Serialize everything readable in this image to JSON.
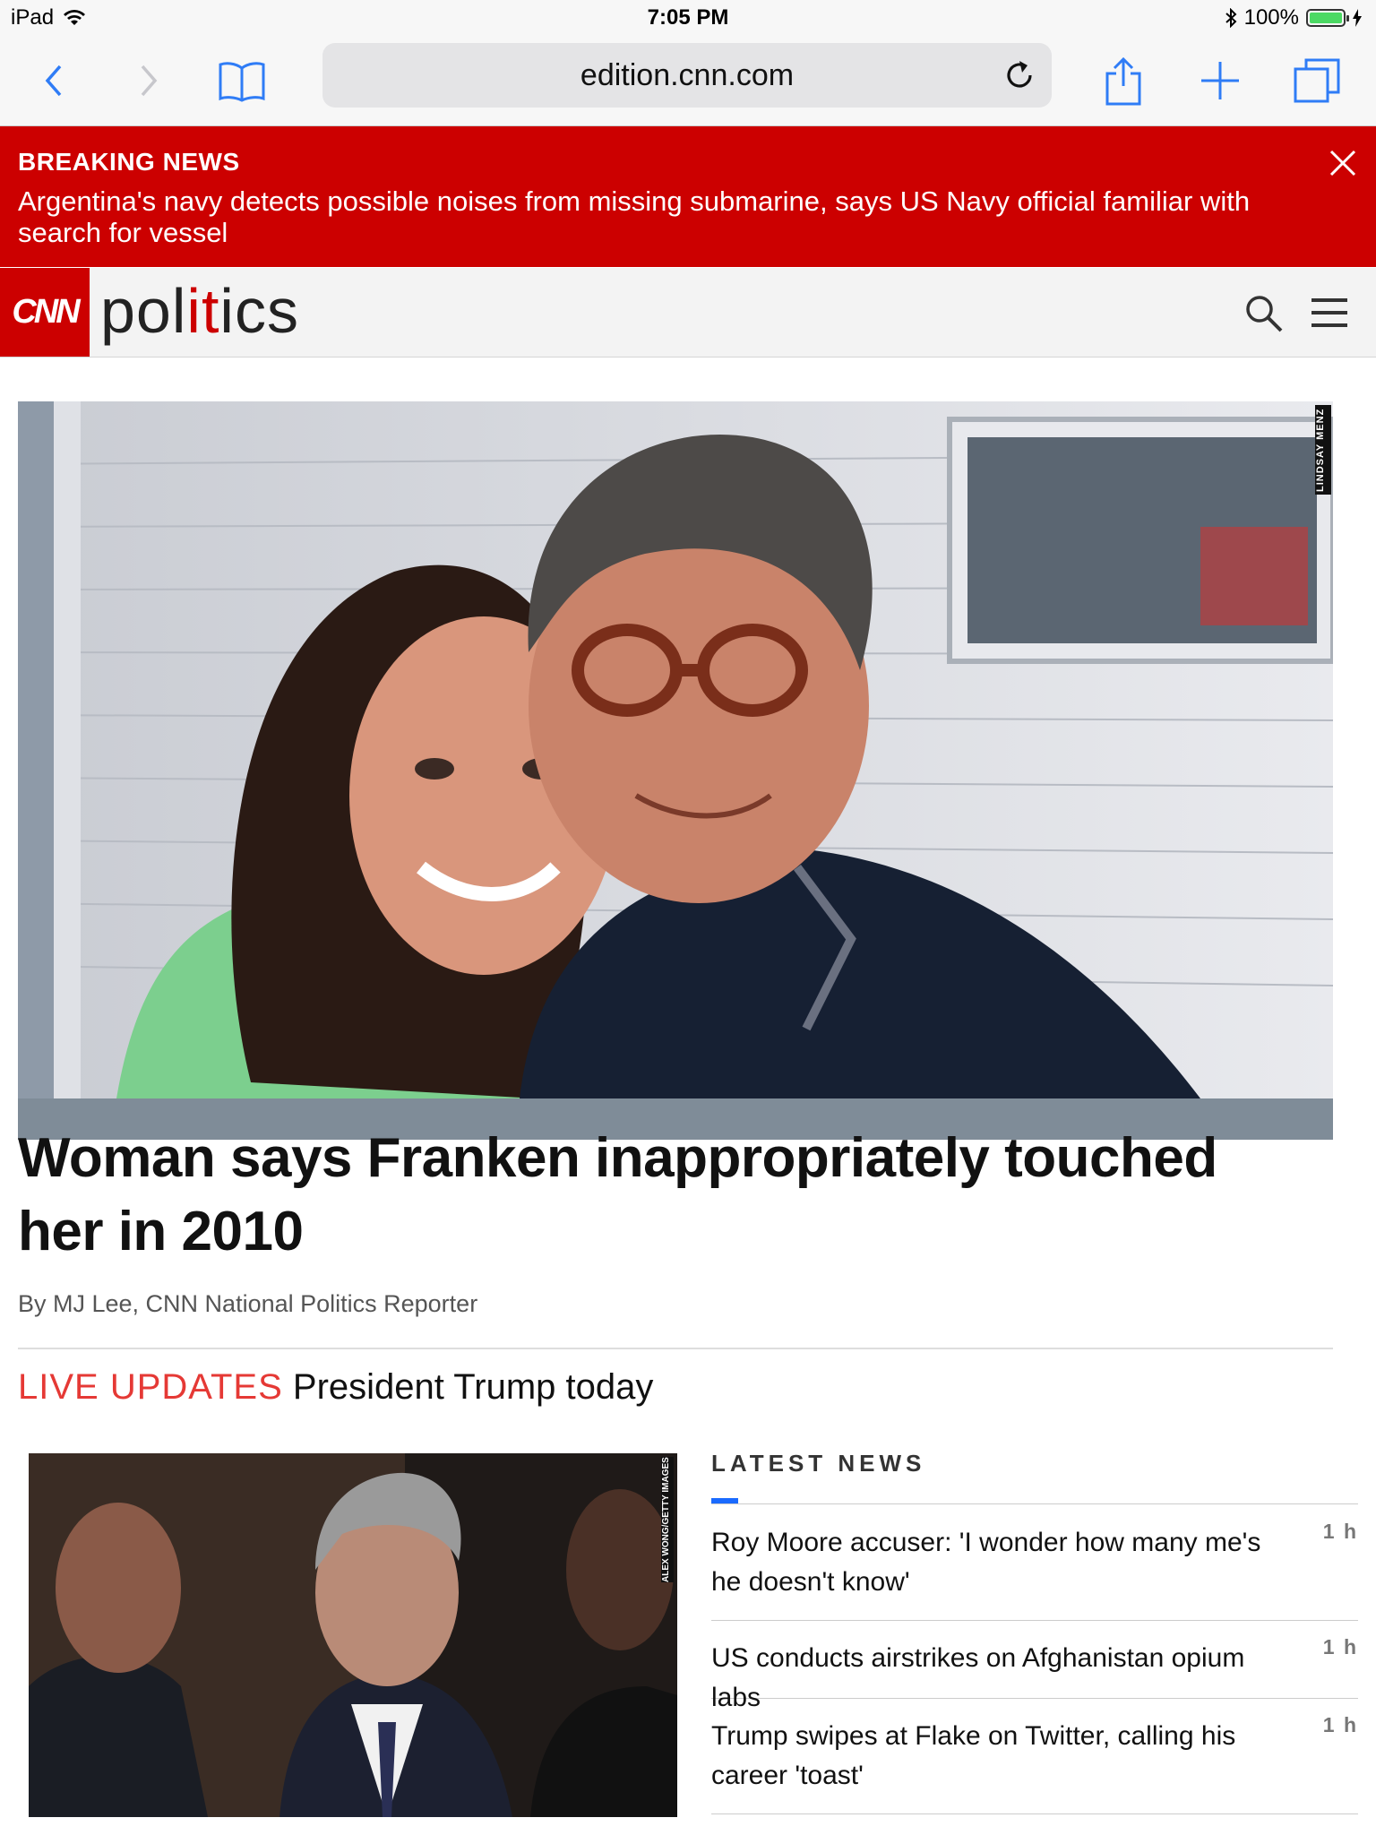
{
  "status_bar": {
    "device": "iPad",
    "time": "7:05 PM",
    "battery": "100%"
  },
  "browser": {
    "url": "edition.cnn.com"
  },
  "breaking": {
    "label": "BREAKING NEWS",
    "text": "Argentina's navy detects possible noises from missing submarine, says US Navy official familiar with search for vessel"
  },
  "header": {
    "logo": "CNN",
    "section_pre": "pol",
    "section_it": "it",
    "section_post": "ics"
  },
  "hero": {
    "credit": "LINDSAY MENZ",
    "headline": "Woman says Franken inappropriately touched her in 2010",
    "byline": "By MJ Lee, CNN National Politics Reporter"
  },
  "live": {
    "tag": "LIVE UPDATES",
    "title": "President Trump today"
  },
  "secondary_image": {
    "credit": "ALEX WONG/GETTY IMAGES"
  },
  "latest": {
    "heading": "LATEST NEWS",
    "items": [
      {
        "title": "Roy Moore accuser: 'I wonder how many me's he doesn't know'",
        "age": "1 h"
      },
      {
        "title": "US conducts airstrikes on Afghanistan opium labs",
        "age": "1 h"
      },
      {
        "title": "Trump swipes at Flake on Twitter, calling his career 'toast'",
        "age": "1 h"
      }
    ]
  },
  "colors": {
    "brand_red": "#cc0000",
    "live_red": "#e53935",
    "accent_blue": "#1a6aff",
    "ios_blue": "#2f7cf6"
  }
}
